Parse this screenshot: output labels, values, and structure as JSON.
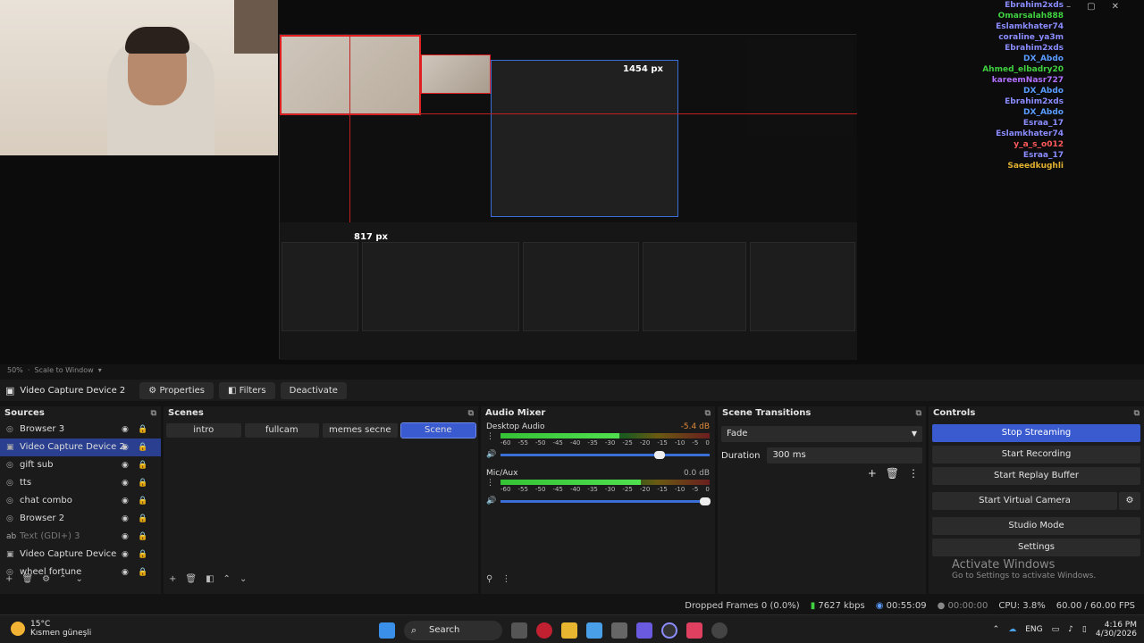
{
  "preview": {
    "px_label_h": "1454 px",
    "px_label_v": "817 px",
    "nested_titles": [
      "Browser 3",
      "Video Capture Device 2",
      "gift sub",
      "tts",
      "chat combo",
      "Browser 2",
      "Text (GDI+) 3",
      "Video Capture Device"
    ]
  },
  "chat": [
    {
      "user": "Ebrahim2xds",
      "color": "#8a8cff",
      "msg": ""
    },
    {
      "user": "Omarsalah888",
      "color": "#3fd13f",
      "msg": ""
    },
    {
      "user": "Eslamkhater74",
      "color": "#8a8cff",
      "msg": ""
    },
    {
      "user": "coraline_ya3m",
      "color": "#8a8cff",
      "msg": ""
    },
    {
      "user": "Ebrahim2xds",
      "color": "#8a8cff",
      "msg": ""
    },
    {
      "user": "DX_Abdo",
      "color": "#5a9bff",
      "msg": ""
    },
    {
      "user": "Ahmed_elbadry20",
      "color": "#3fd13f",
      "msg": ""
    },
    {
      "user": "kareemNasr727",
      "color": "#b070ff",
      "msg": ""
    },
    {
      "user": "DX_Abdo",
      "color": "#5a9bff",
      "msg": ""
    },
    {
      "user": "Ebrahim2xds",
      "color": "#8a8cff",
      "msg": ""
    },
    {
      "user": "DX_Abdo",
      "color": "#5a9bff",
      "msg": ""
    },
    {
      "user": "Esraa_17",
      "color": "#8a8cff",
      "msg": ""
    },
    {
      "user": "Eslamkhater74",
      "color": "#8a8cff",
      "msg": ""
    },
    {
      "user": "y_a_s_o012",
      "color": "#ff5a5a",
      "msg": ""
    },
    {
      "user": "Esraa_17",
      "color": "#8a8cff",
      "msg": ""
    },
    {
      "user": "Saeedkughli",
      "color": "#e0b030",
      "msg": ""
    }
  ],
  "zoom": {
    "level": "50%",
    "mode": "Scale to Window"
  },
  "context": {
    "source": "Video Capture Device 2",
    "properties": "Properties",
    "filters": "Filters",
    "deactivate": "Deactivate"
  },
  "sources": {
    "title": "Sources",
    "items": [
      {
        "label": "Browser 3",
        "icon": "browser-icon",
        "selected": false,
        "dim": false
      },
      {
        "label": "Video Capture Device 2",
        "icon": "camera-icon",
        "selected": true,
        "dim": false
      },
      {
        "label": "gift sub",
        "icon": "browser-icon",
        "selected": false,
        "dim": false
      },
      {
        "label": "tts",
        "icon": "browser-icon",
        "selected": false,
        "dim": false
      },
      {
        "label": "chat combo",
        "icon": "browser-icon",
        "selected": false,
        "dim": false
      },
      {
        "label": "Browser 2",
        "icon": "browser-icon",
        "selected": false,
        "dim": false
      },
      {
        "label": "Text (GDI+) 3",
        "icon": "text-icon",
        "selected": false,
        "dim": true
      },
      {
        "label": "Video Capture Device",
        "icon": "camera-icon",
        "selected": false,
        "dim": false
      },
      {
        "label": "wheel fortune",
        "icon": "browser-icon",
        "selected": false,
        "dim": false
      }
    ]
  },
  "scenes": {
    "title": "Scenes",
    "items": [
      {
        "label": "intro",
        "active": false
      },
      {
        "label": "fullcam",
        "active": false
      },
      {
        "label": "memes secne",
        "active": false
      },
      {
        "label": "Scene",
        "active": true
      }
    ]
  },
  "mixer": {
    "title": "Audio Mixer",
    "ticks": [
      "-60",
      "-55",
      "-50",
      "-45",
      "-40",
      "-35",
      "-30",
      "-25",
      "-20",
      "-15",
      "-10",
      "-5",
      "0"
    ],
    "channels": [
      {
        "name": "Desktop Audio",
        "db": "-5.4 dB",
        "db_color": "#e08a3a",
        "level": 0.57,
        "fader": 0.76
      },
      {
        "name": "Mic/Aux",
        "db": "0.0 dB",
        "db_color": "#aaaaaa",
        "level": 0.67,
        "fader": 0.98
      }
    ]
  },
  "transitions": {
    "title": "Scene Transitions",
    "selected": "Fade",
    "duration_label": "Duration",
    "duration_value": "300 ms"
  },
  "controls": {
    "title": "Controls",
    "stop_streaming": "Stop Streaming",
    "start_recording": "Start Recording",
    "start_replay": "Start Replay Buffer",
    "start_virtual": "Start Virtual Camera",
    "studio_mode": "Studio Mode",
    "settings": "Settings",
    "activate_title": "Activate Windows",
    "activate_sub": "Go to Settings to activate Windows."
  },
  "status": {
    "dropped": "Dropped Frames 0 (0.0%)",
    "bitrate": "7627 kbps",
    "stream_time": "00:55:09",
    "rec_time": "00:00:00",
    "cpu": "CPU: 3.8%",
    "fps": "60.00 / 60.00 FPS"
  },
  "taskbar": {
    "temp": "15°C",
    "weather": "Kısmen güneşli",
    "search": "Search",
    "lang": "ENG",
    "time": "4:16 PM",
    "date": "4/30/2026"
  }
}
